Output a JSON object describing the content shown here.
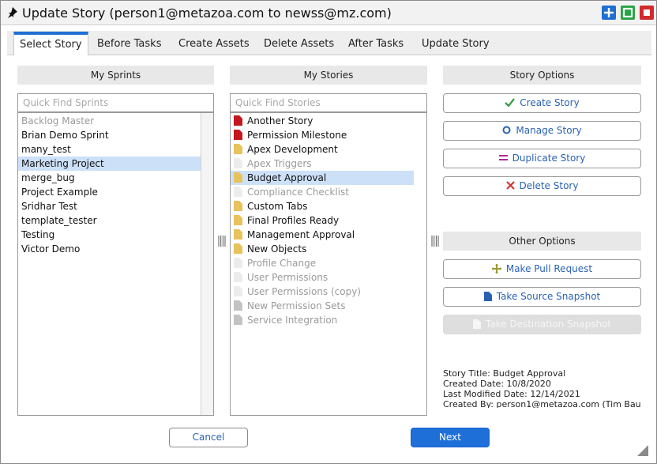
{
  "window": {
    "title": "Update Story (person1@metazoa.com to newss@mz.com)",
    "controls": [
      "plus-icon",
      "maximize-icon",
      "close-icon"
    ]
  },
  "tabs": [
    {
      "label": "Select Story",
      "active": true
    },
    {
      "label": "Before Tasks"
    },
    {
      "label": "Create Assets"
    },
    {
      "label": "Delete Assets"
    },
    {
      "label": "After Tasks"
    },
    {
      "label": "Update Story"
    }
  ],
  "sprints": {
    "header": "My Sprints",
    "search_placeholder": "Quick Find Sprints",
    "items": [
      {
        "label": "Backlog Master",
        "muted": true
      },
      {
        "label": "Brian Demo Sprint"
      },
      {
        "label": "many_test"
      },
      {
        "label": "Marketing Project",
        "selected": true
      },
      {
        "label": "merge_bug"
      },
      {
        "label": "Project Example"
      },
      {
        "label": "Sridhar Test"
      },
      {
        "label": "template_tester"
      },
      {
        "label": "Testing"
      },
      {
        "label": "Victor Demo"
      }
    ]
  },
  "stories": {
    "header": "My Stories",
    "search_placeholder": "Quick Find Stories",
    "items": [
      {
        "label": "Another Story",
        "icon": "red-doc-icon"
      },
      {
        "label": "Permission Milestone",
        "icon": "red-doc-icon"
      },
      {
        "label": "Apex Development",
        "icon": "yellow-doc-icon"
      },
      {
        "label": "Apex Triggers",
        "icon": "white-doc-icon",
        "muted": true
      },
      {
        "label": "Budget Approval",
        "icon": "yellow-doc-icon",
        "selected": true
      },
      {
        "label": "Compliance Checklist",
        "icon": "white-doc-icon",
        "muted": true
      },
      {
        "label": "Custom Tabs",
        "icon": "yellow-doc-icon"
      },
      {
        "label": "Final Profiles Ready",
        "icon": "yellow-doc-icon"
      },
      {
        "label": "Management Approval",
        "icon": "yellow-doc-icon"
      },
      {
        "label": "New Objects",
        "icon": "yellow-doc-icon"
      },
      {
        "label": "Profile Change",
        "icon": "white-doc-icon",
        "muted": true
      },
      {
        "label": "User Permissions",
        "icon": "white-doc-icon",
        "muted": true
      },
      {
        "label": "User Permissions (copy)",
        "icon": "white-doc-icon",
        "muted": true
      },
      {
        "label": "New Permission Sets",
        "icon": "gray-doc-icon",
        "muted": true
      },
      {
        "label": "Service Integration",
        "icon": "gray-doc-icon",
        "muted": true
      }
    ]
  },
  "story_options": {
    "header": "Story Options",
    "buttons": [
      {
        "label": "Create Story",
        "icon": "check-icon"
      },
      {
        "label": "Manage Story",
        "icon": "circle-icon"
      },
      {
        "label": "Duplicate Story",
        "icon": "equals-icon"
      },
      {
        "label": "Delete Story",
        "icon": "x-icon"
      }
    ]
  },
  "other_options": {
    "header": "Other Options",
    "buttons": [
      {
        "label": "Make Pull Request",
        "icon": "plus-arrows-icon"
      },
      {
        "label": "Take Source Snapshot",
        "icon": "document-icon"
      },
      {
        "label": "Take Destination Snapshot",
        "icon": "document-icon",
        "disabled": true
      }
    ]
  },
  "story_info": {
    "title_line": "Story Title: Budget Approval",
    "created_line": "Created Date: 10/8/2020",
    "modified_line": "Last Modified Date: 12/14/2021",
    "created_by_line": "Created By: person1@metazoa.com (Tim Bau"
  },
  "footer": {
    "cancel_label": "Cancel",
    "next_label": "Next"
  },
  "colors": {
    "accent": "#1f6fd8",
    "selection": "#cce0f8",
    "link_text": "#2a62b3",
    "check": "#2a9d3c",
    "delete": "#d33333",
    "equals": "#b0289a"
  }
}
